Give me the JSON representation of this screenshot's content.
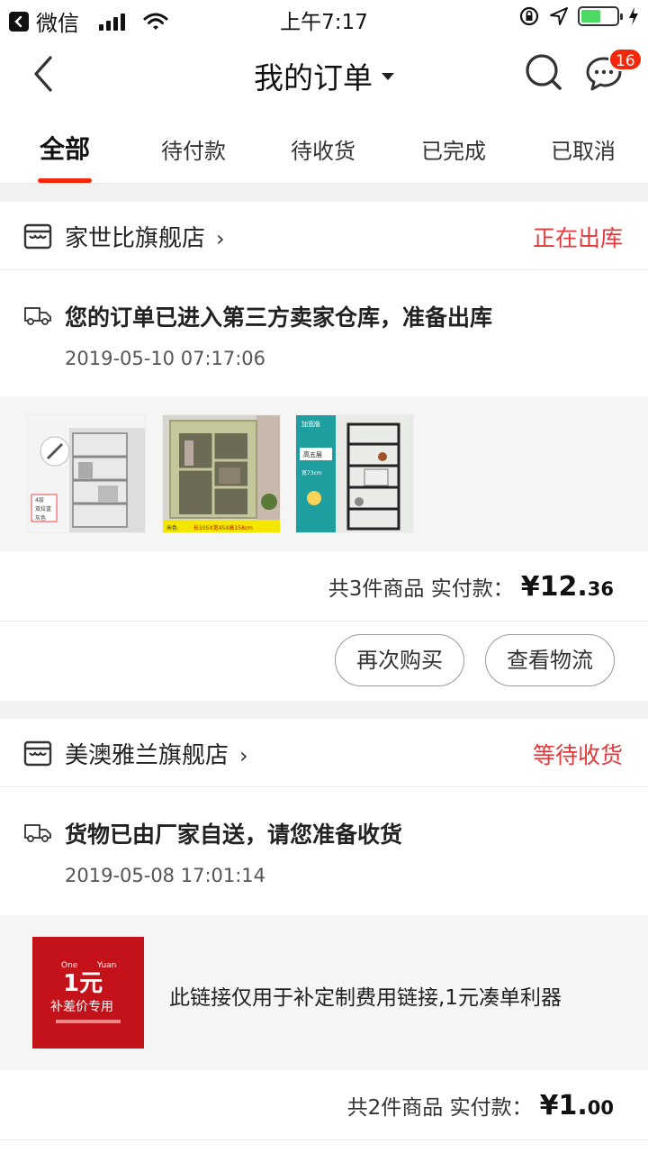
{
  "status_bar": {
    "back_app": "微信",
    "time": "上午7:17"
  },
  "nav": {
    "title": "我的订单",
    "message_badge": "16"
  },
  "tabs": [
    {
      "label": "全部",
      "active": true
    },
    {
      "label": "待付款",
      "active": false
    },
    {
      "label": "待收货",
      "active": false
    },
    {
      "label": "已完成",
      "active": false
    },
    {
      "label": "已取消",
      "active": false
    }
  ],
  "orders": [
    {
      "shop": "家世比旗舰店",
      "status": "正在出库",
      "tracking_text": "您的订单已进入第三方卖家仓库，准备出库",
      "tracking_time": "2019-05-10 07:17:06",
      "thumbnails": [
        {
          "name": "kitchen-rack-thumb",
          "labels": [
            "4层",
            "双拉篮",
            "灰色"
          ]
        },
        {
          "name": "wardrobe-thumb",
          "labels": [
            "米色",
            "长105X宽45X高158cm"
          ]
        },
        {
          "name": "metal-shelf-thumb",
          "labels": [
            "加宽版",
            "高五层",
            "宽73cm"
          ]
        }
      ],
      "summary_prefix": "共3件商品  实付款：",
      "price_major": "¥12.",
      "price_minor": "36",
      "buttons": [
        "再次购买",
        "查看物流"
      ]
    },
    {
      "shop": "美澳雅兰旗舰店",
      "status": "等待收货",
      "tracking_text": "货物已由厂家自送，请您准备收货",
      "tracking_time": "2019-05-08 17:01:14",
      "item_thumb": {
        "top_left": "One",
        "top_right": "Yuan",
        "big": "1元",
        "sub": "补差价专用"
      },
      "item_title": "此链接仅用于补定制费用链接,1元凑单利器",
      "summary_prefix": "共2件商品  实付款：",
      "price_major": "¥1.",
      "price_minor": "00"
    }
  ],
  "colors": {
    "accent": "#f2270c",
    "status_red": "#e4393c",
    "battery_green": "#4cd964"
  }
}
